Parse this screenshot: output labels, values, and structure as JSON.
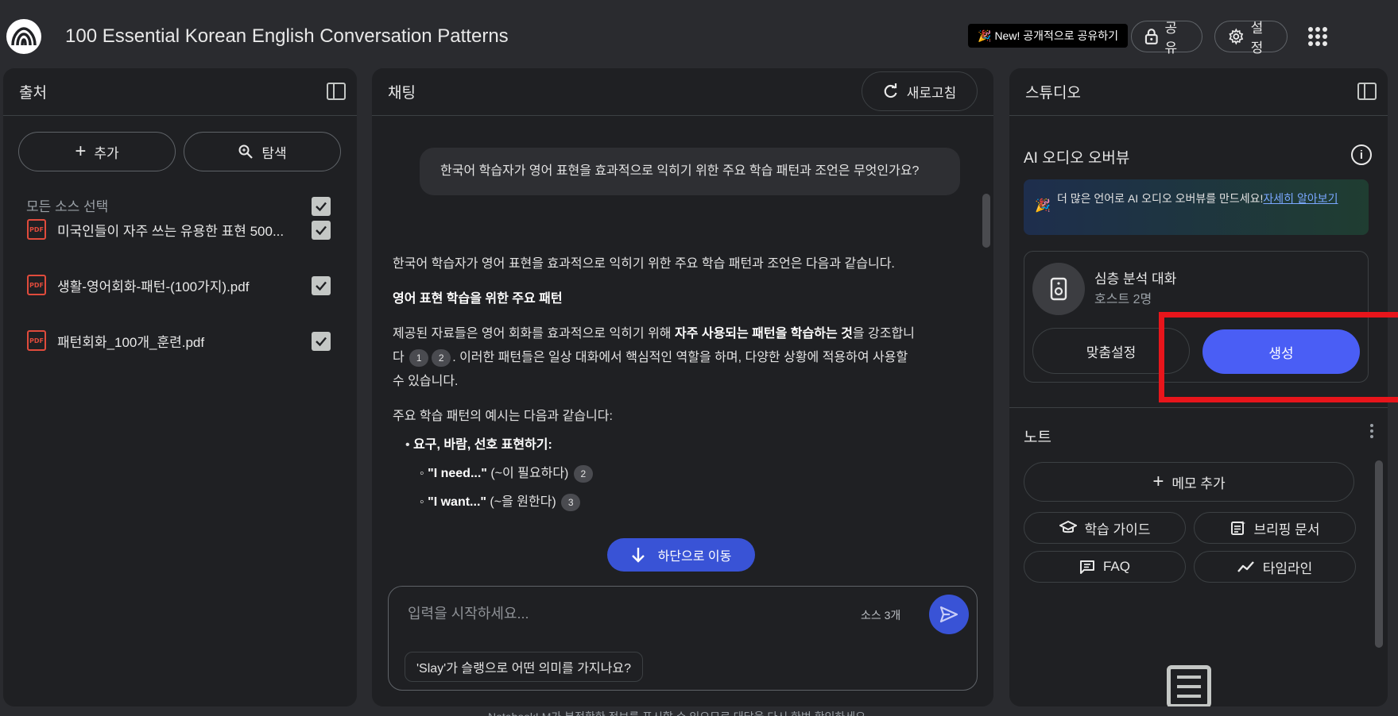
{
  "header": {
    "title": "100 Essential Korean English Conversation Patterns",
    "new_share": "New! 공개적으로 공유하기",
    "share_label": "공유",
    "settings_label": "설정"
  },
  "sources": {
    "title": "출처",
    "add_label": "추가",
    "search_label": "탐색",
    "select_all_label": "모든 소스 선택",
    "items": [
      {
        "name": "미국인들이 자주 쓰는 유용한 표현 500...",
        "checked": true
      },
      {
        "name": "생활-영어회화-패턴-(100가지).pdf",
        "checked": true
      },
      {
        "name": "패턴회화_100개_훈련.pdf",
        "checked": true
      }
    ]
  },
  "chat": {
    "title": "채팅",
    "refresh_label": "새로고침",
    "user_message": "한국어 학습자가 영어 표현을 효과적으로 익히기 위한 주요 학습 패턴과 조언은 무엇인가요?",
    "answer": {
      "intro": "한국어 학습자가 영어 표현을 효과적으로 익히기 위한 주요 학습 패턴과 조언은 다음과 같습니다.",
      "heading": "영어 표현 학습을 위한 주요 패턴",
      "p1_before": "제공된 자료들은 영어 회화를 효과적으로 익히기 위해 ",
      "p1_bold": "자주 사용되는 패턴을 학습하는 것",
      "p1_mid": "을 강조합니다",
      "p1_after": ". 이러한 패턴들은 일상 대화에서 핵심적인 역할을 하며, 다양한 상황에 적용하여 사용할 수 있습니다.",
      "cite1": "1",
      "cite2": "2",
      "cite3": "3",
      "examples_intro": "주요 학습 패턴의 예시는 다음과 같습니다:",
      "bullet1": "요구, 바람, 선호 표현하기:",
      "sub1_bold": "\"I need...\"",
      "sub1_rest": " (~이 필요하다)",
      "sub2_bold": "\"I want...\"",
      "sub2_rest": " (~을 원한다)"
    },
    "scroll_bottom_label": "하단으로 이동",
    "input_placeholder": "입력을 시작하세요...",
    "source_count": "소스 3개",
    "suggestion": "'Slay'가 슬랭으로 어떤 의미를 가지나요?",
    "disclaimer": "NotebookLM가 부정확한 정보를 표시할 수 있으므로 대답을 다시 한번 확인하세요."
  },
  "studio": {
    "title": "스튜디오",
    "audio_overview_title": "AI 오디오 오버뷰",
    "promo_text": "더 많은 언어로 AI 오디오 오버뷰를 만드세요!",
    "promo_link": "자세히 알아보기",
    "deep_dive_title": "심층 분석 대화",
    "deep_dive_hosts": "호스트 2명",
    "customize_label": "맞춤설정",
    "generate_label": "생성",
    "notes_title": "노트",
    "add_note_label": "메모 추가",
    "study_guide_label": "학습 가이드",
    "briefing_label": "브리핑 문서",
    "faq_label": "FAQ",
    "timeline_label": "타임라인"
  },
  "colors": {
    "accent": "#4a5ef5",
    "highlight_box": "#e8151b",
    "pdf": "#e04b3c"
  }
}
